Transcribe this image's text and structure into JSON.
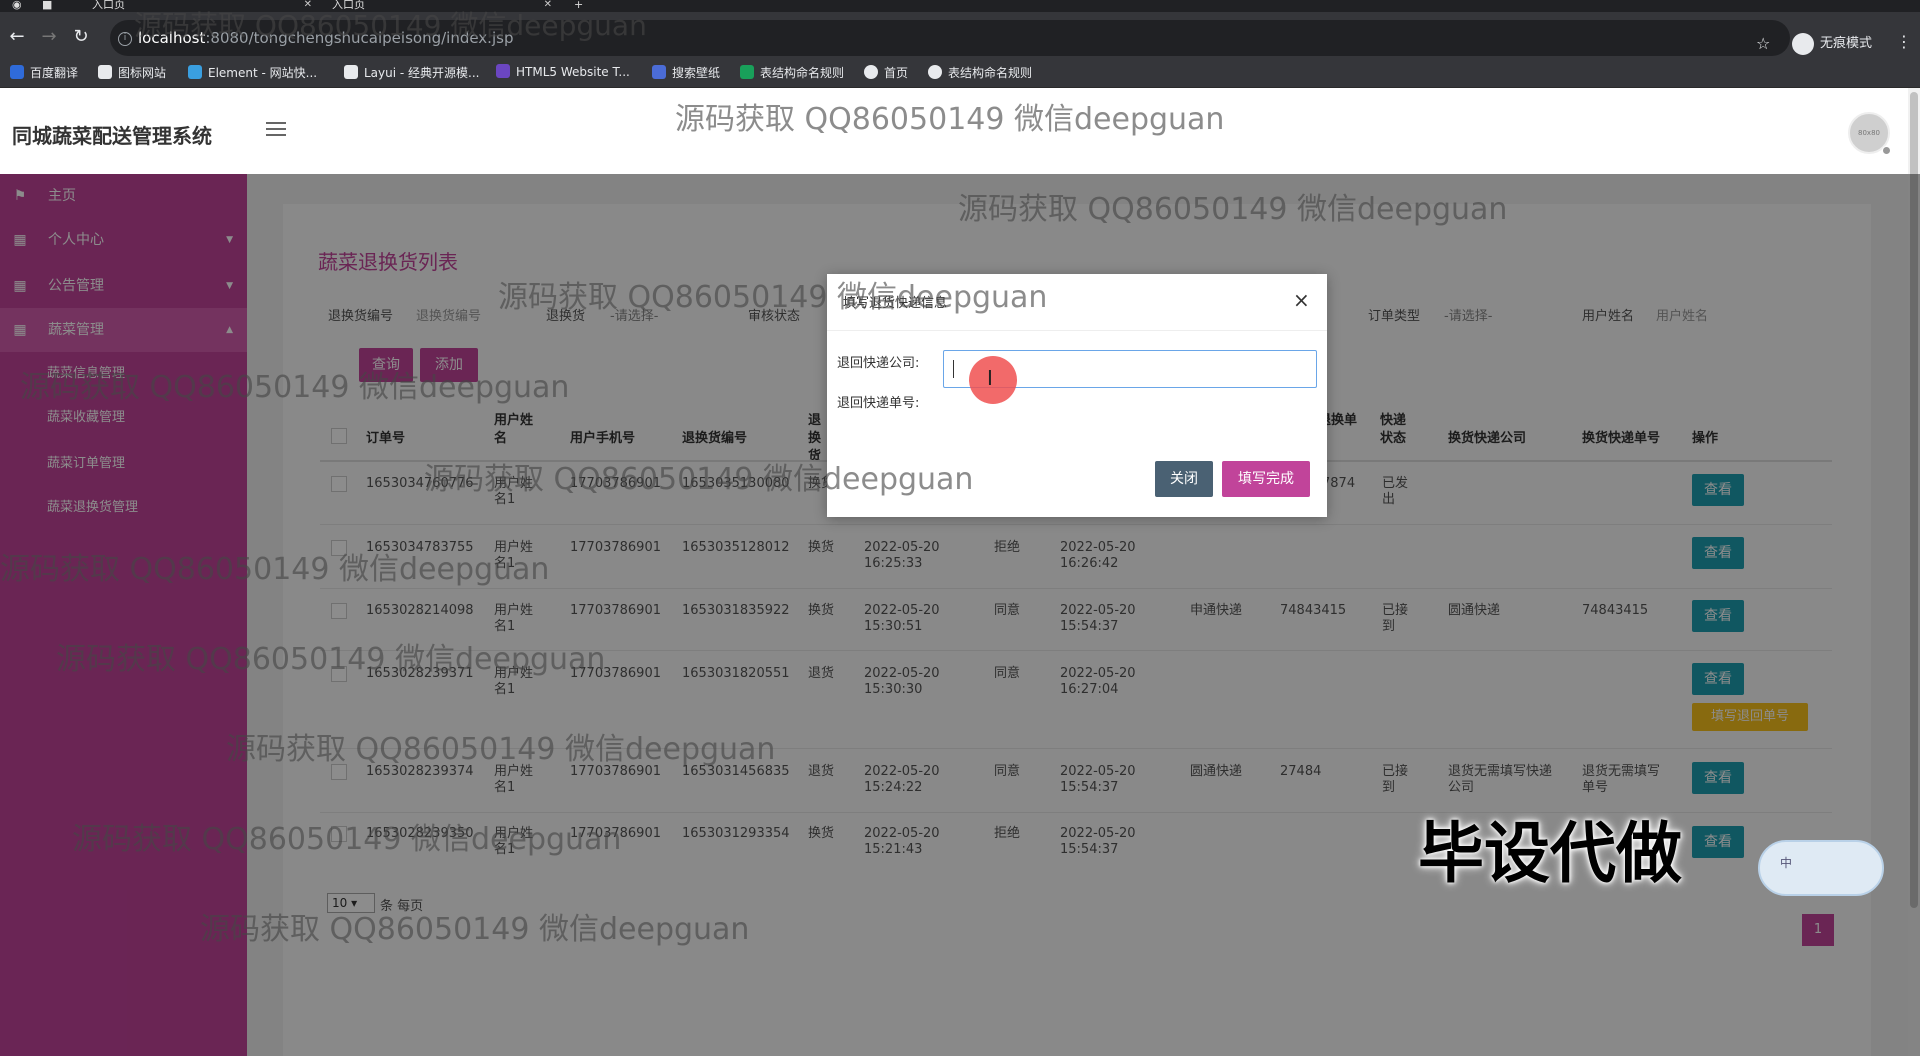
{
  "browser": {
    "tabs": [
      {
        "title": "入口页"
      },
      {
        "title": "入口页"
      }
    ],
    "url_host": "localhost",
    "url_path": ":8080/tongchengshucaipeisong/index.jsp",
    "incognito_label": "无痕模式",
    "bookmarks": [
      {
        "label": "百度翻译",
        "color": "#2f6bd9"
      },
      {
        "label": "图标网站",
        "color": "#e8eaed"
      },
      {
        "label": "Element - 网站快...",
        "color": "#3a9fe0"
      },
      {
        "label": "Layui - 经典开源模...",
        "color": "#e8eaed"
      },
      {
        "label": "HTML5 Website T...",
        "color": "#6b46c1"
      },
      {
        "label": "搜索壁纸",
        "color": "#4b6cd6"
      },
      {
        "label": "表结构命名规则",
        "color": "#19a05a"
      },
      {
        "label": "首页",
        "color": "#e8eaed"
      },
      {
        "label": "表结构命名规则",
        "color": "#e8eaed"
      }
    ]
  },
  "app": {
    "title": "同城蔬菜配送管理系统",
    "avatar_text": "80x80"
  },
  "sidebar": {
    "items": [
      {
        "label": "主页",
        "icon": "flag-icon"
      },
      {
        "label": "个人中心",
        "icon": "grid-icon",
        "arrow": "▼"
      },
      {
        "label": "公告管理",
        "icon": "grid-icon",
        "arrow": "▼"
      },
      {
        "label": "蔬菜管理",
        "icon": "grid-icon",
        "arrow": "▲"
      }
    ],
    "subitems": [
      {
        "label": "蔬菜信息管理"
      },
      {
        "label": "蔬菜收藏管理"
      },
      {
        "label": "蔬菜订单管理"
      },
      {
        "label": "蔬菜退换货管理"
      }
    ]
  },
  "page": {
    "title": "蔬菜退换货列表",
    "filters": {
      "code_label": "退换货编号",
      "code_placeholder": "退换货编号",
      "type_label": "退换货",
      "type_value": "-请选择-",
      "status_label": "审核状态",
      "order_type_label": "订单类型",
      "order_type_value": "-请选择-",
      "user_label": "用户姓名",
      "user_placeholder": "用户姓名"
    },
    "query_button": "查询",
    "add_button": "添加",
    "columns": [
      "订单号",
      "用户姓名",
      "用户手机号",
      "退换货编号",
      "退换货",
      "退换单",
      "快递状态",
      "换货快递公司",
      "换货快递单号",
      "操作"
    ],
    "rows": [
      {
        "order": "1653034760776",
        "user": "用户姓名1",
        "phone": "17703786901",
        "code": "1653035130080",
        "kind": "换货",
        "apply": "",
        "audit": "",
        "reply": "",
        "company": "",
        "tracking": "7874",
        "express_status": "已发出",
        "ex_company": "",
        "ex_tracking": ""
      },
      {
        "order": "1653034783755",
        "user": "用户姓名1",
        "phone": "17703786901",
        "code": "1653035128012",
        "kind": "换货",
        "apply": "2022-05-20 16:25:33",
        "audit": "拒绝",
        "reply": "2022-05-20 16:26:42",
        "company": "",
        "tracking": "",
        "express_status": "",
        "ex_company": "",
        "ex_tracking": ""
      },
      {
        "order": "1653028214098",
        "user": "用户姓名1",
        "phone": "17703786901",
        "code": "1653031835922",
        "kind": "换货",
        "apply": "2022-05-20 15:30:51",
        "audit": "同意",
        "reply": "2022-05-20 15:54:37",
        "company": "申通快递",
        "tracking": "74843415",
        "express_status": "已接到",
        "ex_company": "圆通快递",
        "ex_tracking": "74843415"
      },
      {
        "order": "1653028239371",
        "user": "用户姓名1",
        "phone": "17703786901",
        "code": "1653031820551",
        "kind": "退货",
        "apply": "2022-05-20 15:30:30",
        "audit": "同意",
        "reply": "2022-05-20 16:27:04",
        "company": "",
        "tracking": "",
        "express_status": "",
        "ex_company": "",
        "ex_tracking": ""
      },
      {
        "order": "1653028239374",
        "user": "用户姓名1",
        "phone": "17703786901",
        "code": "1653031456835",
        "kind": "退货",
        "apply": "2022-05-20 15:24:22",
        "audit": "同意",
        "reply": "2022-05-20 15:54:37",
        "company": "圆通快递",
        "tracking": "27484",
        "express_status": "已接到",
        "ex_company": "退货无需填写快递公司",
        "ex_tracking": "退货无需填写单号"
      },
      {
        "order": "1653028239350",
        "user": "用户姓名1",
        "phone": "17703786901",
        "code": "1653031293354",
        "kind": "换货",
        "apply": "2022-05-20 15:21:43",
        "audit": "拒绝",
        "reply": "2022-05-20 15:54:37",
        "company": "",
        "tracking": "",
        "express_status": "",
        "ex_company": "",
        "ex_tracking": ""
      }
    ],
    "view_button": "查看",
    "fill_back_button": "填写退回单号",
    "page_size": "10",
    "page_size_label": "条 每页",
    "current_page": "1"
  },
  "modal": {
    "title": "填写退货快递信息",
    "company_label": "退回快递公司:",
    "tracking_label": "退回快递单号:",
    "company_value": "",
    "close_button": "关闭",
    "done_button": "填写完成"
  },
  "watermark": {
    "text": "源码获取 QQ86050149 微信deepguan",
    "big": "毕设代做",
    "widget_label": "中"
  }
}
